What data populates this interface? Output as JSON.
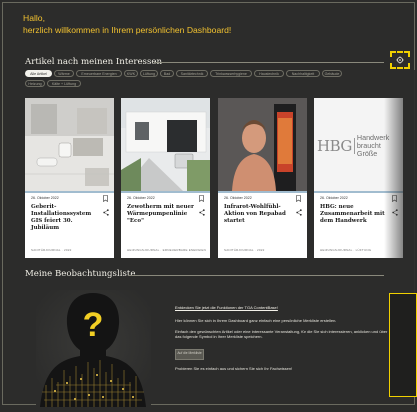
{
  "greeting": {
    "line1": "Hallo,",
    "line2": "herzlich willkommen in Ihrem persönlichen Dashboard!"
  },
  "interests": {
    "title": "Artikel nach meinen Interessen",
    "settings_icon": "gear-icon",
    "filters": [
      {
        "label": "Alle Artikel",
        "active": true
      },
      {
        "label": "Wärme",
        "active": false
      },
      {
        "label": "Erneuerbare Energien",
        "active": false
      },
      {
        "label": "KWK",
        "active": false
      },
      {
        "label": "Lüftung",
        "active": false
      },
      {
        "label": "Bad",
        "active": false
      },
      {
        "label": "Sanitärtechnik",
        "active": false
      },
      {
        "label": "Trinkwasserhygiene",
        "active": false
      },
      {
        "label": "Haustechnik",
        "active": false
      },
      {
        "label": "Nachhaltigkeit",
        "active": false
      },
      {
        "label": "Gebäude",
        "active": false
      },
      {
        "label": "Heizung",
        "active": false
      },
      {
        "label": "Kälte + Lüftung",
        "active": false
      }
    ]
  },
  "articles": [
    {
      "date": "26. Oktober 2022",
      "title": "Geberit-Installationssystem GIS feiert 30. Jubiläum",
      "source": "SANITÄRJOURNAL · 2022"
    },
    {
      "date": "26. Oktober 2022",
      "title": "Zewotherm mit neuer Wärmepumpenlinie \"Eco\"",
      "source": "HEIZUNGSJOURNAL · ERNEUERBARE ENERGIEN"
    },
    {
      "date": "26. Oktober 2022",
      "title": "Infrarot-Wohlfühl-Aktion von Repabad startet",
      "source": "SANITÄRJOURNAL · 2022"
    },
    {
      "date": "26. Oktober 2022",
      "title": "HBG: neue Zusammenarbeit mit dem Handwerk",
      "source": "HEIZUNGSJOURNAL · LÜFTUNG",
      "logo_line1": "Handwerk",
      "logo_line2": "braucht Größe",
      "logo_mark": "HBG"
    }
  ],
  "watchlist": {
    "title": "Meine Beobachtungsliste",
    "link": "Entdecken Sie jetzt die Funktionen der TGA ContentBase!",
    "p1": "Hier können Sie sich in Ihrem Dashboard ganz einfach eine persönliche Merkliste erstellen.",
    "p2": "Einfach den gewünschten Artikel oder eine interessante Veranstaltung, für die Sie sich interessieren, anklicken und über das folgende Symbol in Ihrer Merkliste speichern.",
    "button_label": "Auf die Merkliste",
    "p3": "Probieren Sie es einfach aus und sichern Sie sich Ihr Fachwissen!",
    "silhouette_mark": "?"
  }
}
